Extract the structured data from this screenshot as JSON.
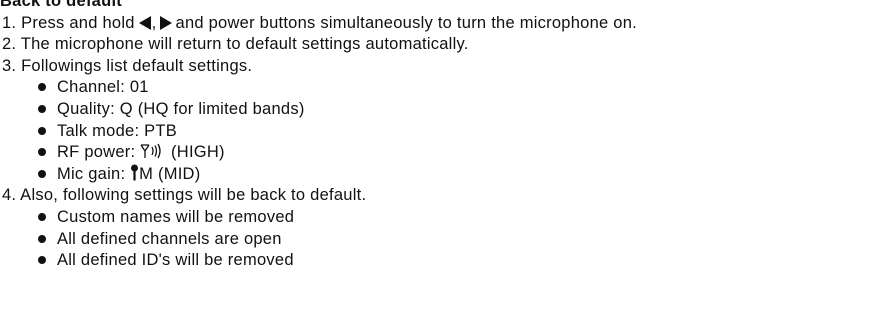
{
  "heading": "Back to default",
  "steps": {
    "step1_prefix": "1. Press and hold",
    "step1_sep": ",",
    "step1_suffix": "and power buttons simultaneously to turn the microphone on.",
    "step2": "2. The microphone will return to default settings automatically.",
    "step3": "3. Followings list default settings.",
    "step4": "4. Also, following settings will be back to default."
  },
  "defaults": {
    "channel": "Channel: 01",
    "quality": "Quality: Q (HQ for limited bands)",
    "talk_mode": "Talk mode: PTB",
    "rf_power_label": "RF power:",
    "rf_power_value": "(HIGH)",
    "mic_gain_label": "Mic gain:",
    "mic_gain_value": "M (MID)"
  },
  "also_default": [
    "Custom names will be removed",
    "All defined channels are open",
    "All defined ID's will be removed"
  ],
  "icons": {
    "left_button": "left-triangle-icon",
    "right_button": "right-triangle-icon",
    "rf_power": "antenna-signal-icon",
    "mic_gain": "microphone-icon"
  }
}
